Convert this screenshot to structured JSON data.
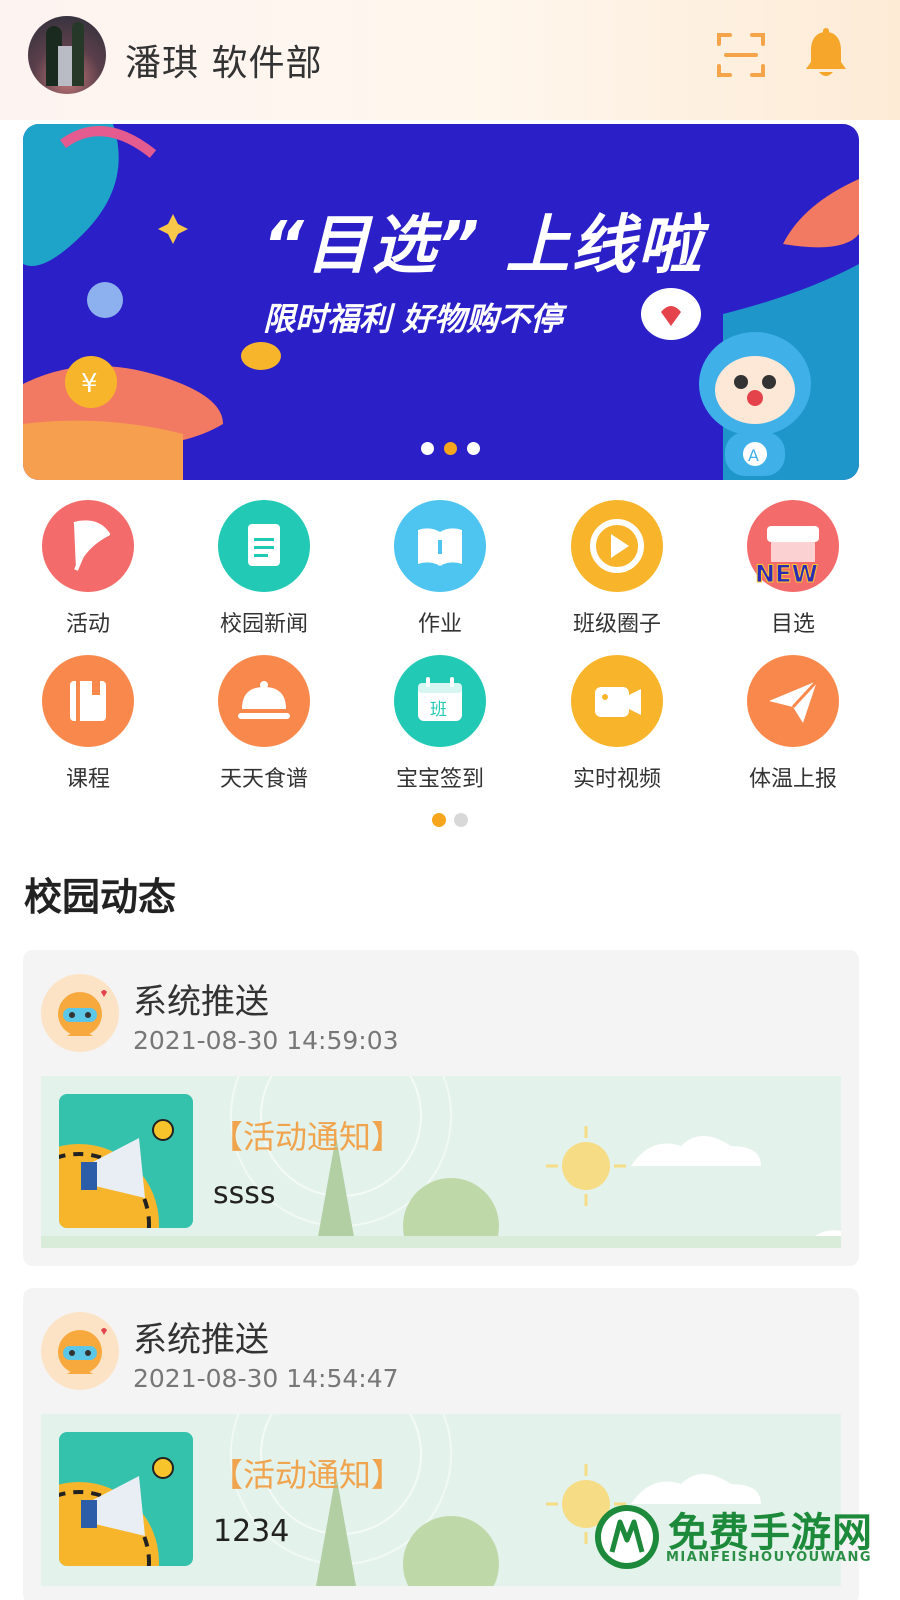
{
  "header": {
    "user_name": "潘琪 软件部"
  },
  "banner": {
    "title": "“目选” 上线啦",
    "subtitle": "限时福利 好物购不停",
    "active_dot_index": 1,
    "dot_count": 3
  },
  "grid": {
    "items": [
      {
        "label": "活动",
        "icon": "flag-icon",
        "color": "#f46b6b"
      },
      {
        "label": "校园新闻",
        "icon": "document-icon",
        "color": "#22c9b5"
      },
      {
        "label": "作业",
        "icon": "book-icon",
        "color": "#4dc5f0"
      },
      {
        "label": "班级圈子",
        "icon": "play-icon",
        "color": "#f8b52b"
      },
      {
        "label": "目选",
        "icon": "shop-new-icon",
        "color": "#f46b6b"
      },
      {
        "label": "课程",
        "icon": "notebook-icon",
        "color": "#f9884d"
      },
      {
        "label": "天天食谱",
        "icon": "dish-icon",
        "color": "#f9884d"
      },
      {
        "label": "宝宝签到",
        "icon": "calendar-icon",
        "color": "#22c9b5",
        "badge": "班"
      },
      {
        "label": "实时视频",
        "icon": "video-icon",
        "color": "#f8b52b"
      },
      {
        "label": "体温上报",
        "icon": "paper-plane-icon",
        "color": "#f9884d"
      }
    ],
    "page_count": 2,
    "active_page": 0
  },
  "section": {
    "title": "校园动态"
  },
  "feed": [
    {
      "sender": "系统推送",
      "time": "2021-08-30 14:59:03",
      "tag": "【活动通知】",
      "text": "ssss"
    },
    {
      "sender": "系统推送",
      "time": "2021-08-30 14:54:47",
      "tag": "【活动通知】",
      "text": "1234"
    }
  ],
  "watermark": {
    "title": "免费手游网",
    "subtitle": "MIANFEISHOUYOUWANG"
  }
}
